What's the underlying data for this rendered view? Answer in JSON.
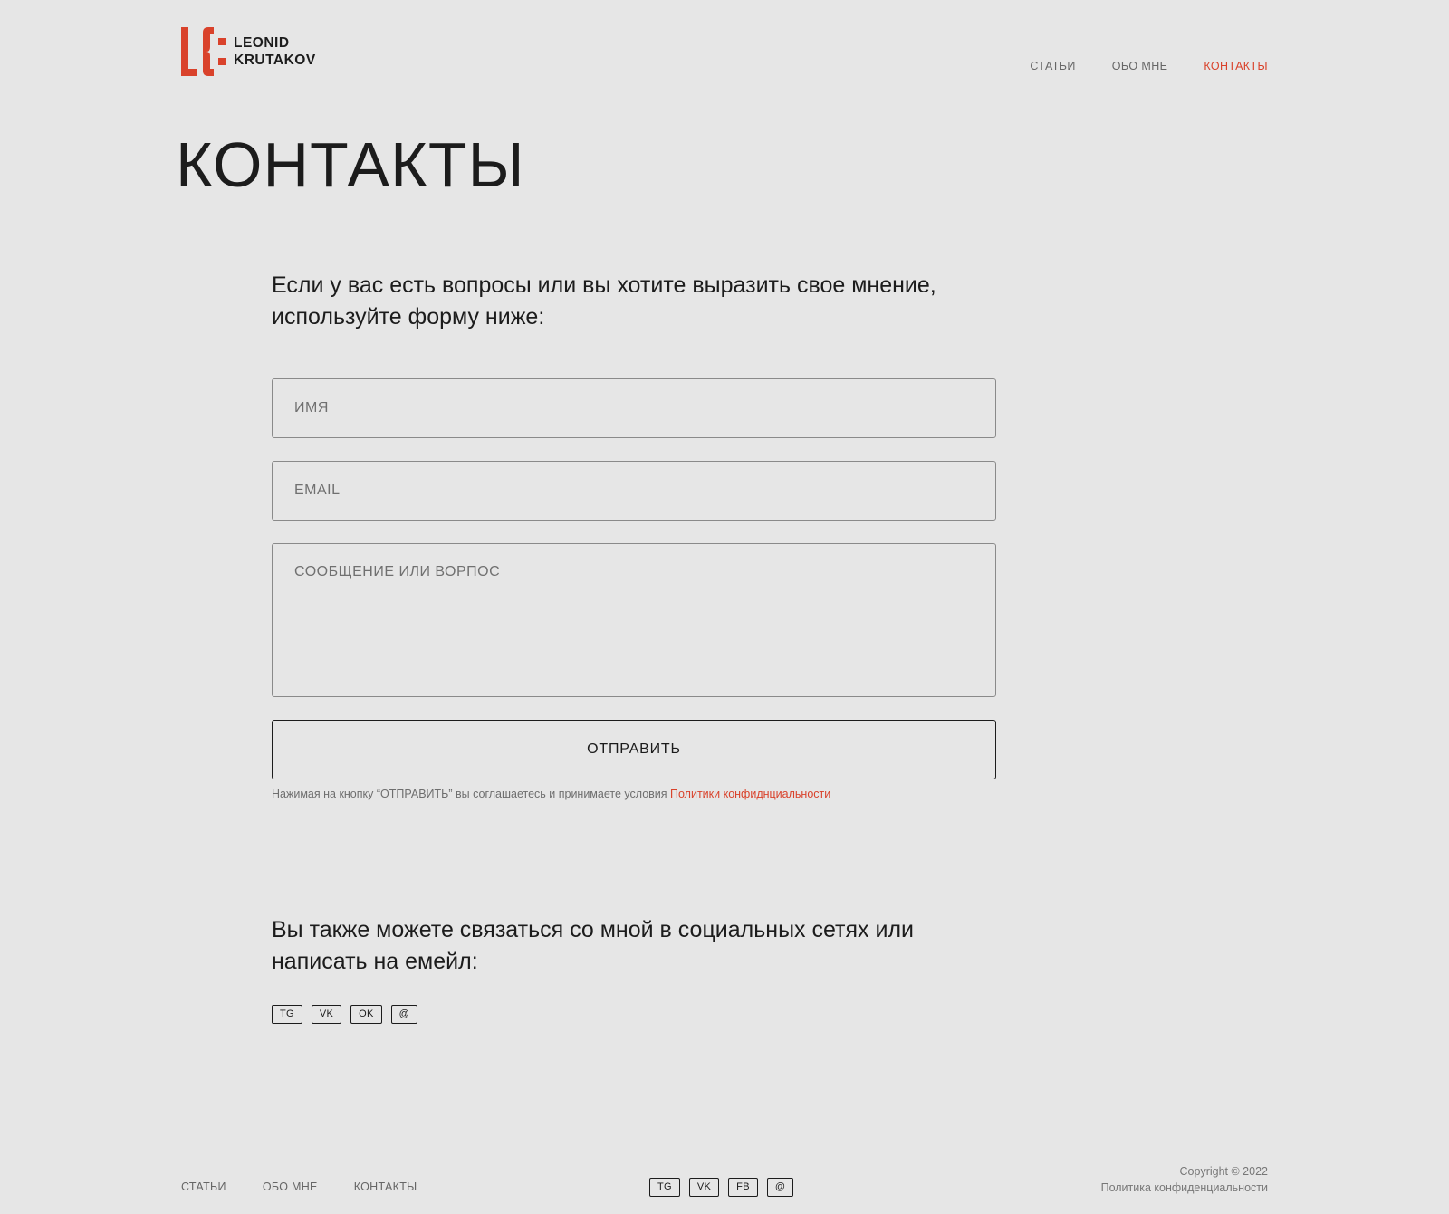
{
  "colors": {
    "background": "#e6e6e6",
    "accent": "#d9422b",
    "text": "#1c1c1c",
    "muted": "#666666"
  },
  "logo": {
    "icon": "kf-monogram-icon",
    "line1": "LEONID",
    "line2": "KRUTAKOV"
  },
  "nav": {
    "items": [
      {
        "label": "СТАТЬИ",
        "active": false
      },
      {
        "label": "ОБО МНЕ",
        "active": false
      },
      {
        "label": "КОНТАКТЫ",
        "active": true
      }
    ]
  },
  "page": {
    "title": "КОНТАКТЫ"
  },
  "form": {
    "intro": "Если у вас есть вопросы или вы хотите выразить свое мнение, используйте форму ниже:",
    "name_placeholder": "ИМЯ",
    "email_placeholder": "EMAIL",
    "message_placeholder": "СООБЩЕНИЕ ИЛИ ВОРПОС",
    "submit_label": "ОТПРАВИТЬ",
    "consent_text": "Нажимая на кнопку “ОТПРАВИТЬ” вы соглашаетесь и принимаете условия ",
    "consent_link": "Политики конфиднциальности"
  },
  "social": {
    "intro": "Вы также можете связаться со мной в социальных сетях или написать на емейл:",
    "links": [
      "TG",
      "VK",
      "OK",
      "@"
    ]
  },
  "footer": {
    "nav": [
      "СТАТЬИ",
      "ОБО МНЕ",
      "КОНТАКТЫ"
    ],
    "social": [
      "TG",
      "VK",
      "FB",
      "@"
    ],
    "copyright": "Copyright © 2022",
    "privacy": "Политика конфиденциальности"
  }
}
